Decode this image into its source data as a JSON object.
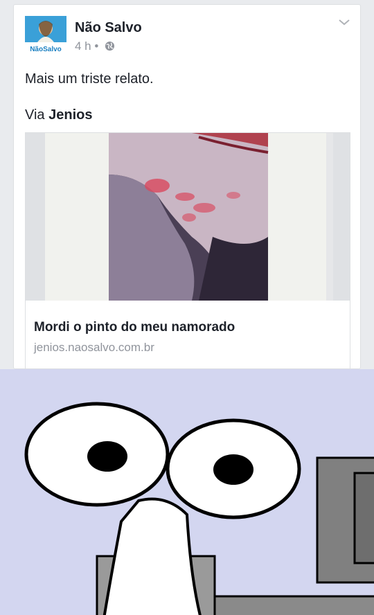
{
  "post": {
    "page_name": "Não Salvo",
    "avatar_text": "NãoSalvo",
    "time": "4 h",
    "separator": "•",
    "message": "Mais um triste relato.",
    "via_prefix": "Via ",
    "via_name": "Jenios"
  },
  "link": {
    "title": "Mordi o pinto do meu namorado",
    "domain": "jenios.naosalvo.com.br"
  },
  "icons": [
    "globe-icon",
    "chevron-down-icon"
  ],
  "colors": {
    "background": "#e9ebee",
    "text_primary": "#1d2129",
    "text_secondary": "#90949c",
    "meme_background": "#d3d6f0"
  }
}
